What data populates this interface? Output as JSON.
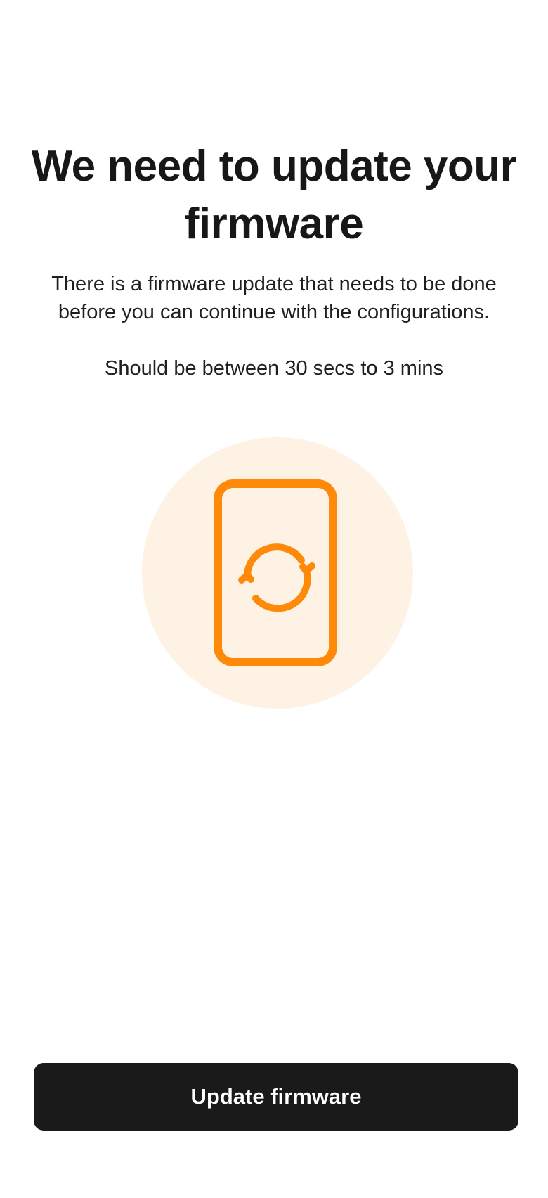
{
  "screen": {
    "title": "We need to update your firmware",
    "description": "There is a firmware update that needs to be done before you can continue with the configurations.",
    "duration_note": "Should be between 30 secs to 3 mins"
  },
  "illustration": {
    "icon": "phone-sync-icon",
    "accent_color": "#FF8A0A",
    "background_color": "#FDF2E3"
  },
  "actions": {
    "primary_label": "Update firmware",
    "primary_color": "#1A1A1A"
  }
}
